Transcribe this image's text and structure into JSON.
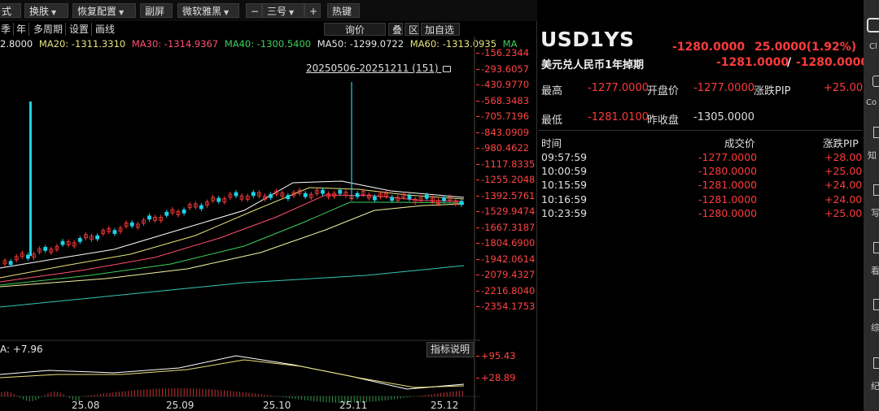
{
  "toolbar": {
    "items": [
      {
        "label": "式",
        "caret": false
      },
      {
        "label": "换肤",
        "caret": true
      },
      {
        "label": "恢复配置",
        "caret": true
      },
      {
        "label": "副屏",
        "caret": false
      },
      {
        "label": "微软雅黑",
        "caret": true
      },
      {
        "label": "−",
        "caret": false
      },
      {
        "label": "三号",
        "caret": true
      },
      {
        "label": "+",
        "caret": false
      },
      {
        "label": "热键",
        "caret": false
      }
    ]
  },
  "periods": [
    "季",
    "年",
    "多周期",
    "设置",
    "画线"
  ],
  "actions": {
    "inquiry": "询价",
    "overlay": "叠",
    "zone": "区",
    "watchlist": "加自选"
  },
  "ma_row": {
    "first": "2.8000",
    "ma20": "MA20: -1311.3310",
    "ma30": "MA30: -1314.9367",
    "ma40": "MA40: -1300.5400",
    "ma50": "MA50: -1299.0722",
    "ma60": "MA60: -1313.0935",
    "tail": "MA"
  },
  "range_label": "20250506-20251211 (151)",
  "price_axis": [
    "-156.2344",
    "-293.6057",
    "-430.9770",
    "-568.3483",
    "-705.7196",
    "-843.0909",
    "-980.4622",
    "-1117.8335",
    "-1255.2048",
    "-1392.5761",
    "-1529.9474",
    "-1667.3187",
    "-1804.6900",
    "-1942.0614",
    "-2079.4327",
    "-2216.8040",
    "-2354.1753"
  ],
  "indicator": {
    "label": "A: +7.96",
    "help": "指标说明",
    "axis": [
      "+95.43",
      "+28.89"
    ]
  },
  "date_axis": [
    "25.08",
    "25.09",
    "25.10",
    "25.11",
    "25.12"
  ],
  "quote": {
    "symbol": "USD1YS",
    "name": "美元兑人民币1年掉期",
    "last": "-1280.0000",
    "change": "25.0000(1.92%)",
    "bid": "-1281.0000",
    "slash": "/",
    "ask": "-1280.0000",
    "high_label": "最高",
    "high": "-1277.0000",
    "open_label": "开盘价",
    "open": "-1277.0000",
    "pip_label": "涨跌PIP",
    "pip": "+25.00",
    "low_label": "最低",
    "low": "-1281.0100",
    "prev_label": "昨收盘",
    "prev": "-1305.0000"
  },
  "trades": {
    "headers": [
      "时间",
      "成交价",
      "涨跌PIP"
    ],
    "rows": [
      [
        "09:57:59",
        "-1277.0000",
        "+28.00"
      ],
      [
        "10:00:59",
        "-1280.0000",
        "+25.00"
      ],
      [
        "10:15:59",
        "-1281.0000",
        "+24.00"
      ],
      [
        "10:16:59",
        "-1281.0000",
        "+24.00"
      ],
      [
        "10:23:59",
        "-1280.0000",
        "+25.00"
      ]
    ]
  },
  "sidebar": [
    "Cl",
    "Co",
    "知",
    "写",
    "看",
    "综",
    "纪"
  ],
  "colors": {
    "up": "#ff3b3b",
    "down": "#1fd1e8",
    "ma20": "#e8e37a",
    "ma30": "#ff4f6e",
    "ma40": "#3ccf5a",
    "ma50": "#e8e8e8",
    "ma60": "#e7e37b"
  }
}
